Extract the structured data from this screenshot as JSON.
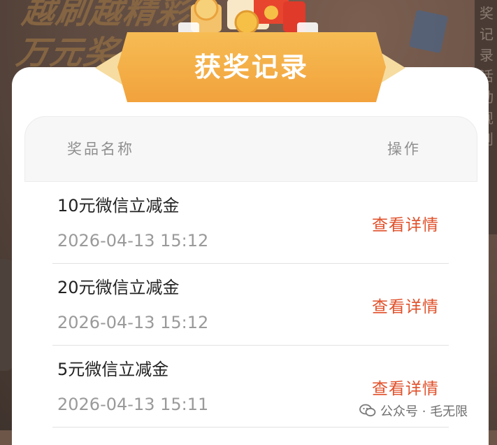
{
  "background": {
    "banner_text": "越刷越精彩\n万元奖",
    "side_text": "奖记录活动规则"
  },
  "modal": {
    "title": "获奖记录",
    "table": {
      "columns": [
        "奖品名称",
        "操作"
      ],
      "rows": [
        {
          "prize": "10元微信立减金",
          "time": "2026-04-13 15:12",
          "action": "查看详情"
        },
        {
          "prize": "20元微信立减金",
          "time": "2026-04-13 15:12",
          "action": "查看详情"
        },
        {
          "prize": "5元微信立减金",
          "time": "2026-04-13 15:11",
          "action": "查看详情"
        }
      ]
    }
  },
  "watermark": {
    "text": "公众号 · 毛无限",
    "icon": "wechat-official-account-icon"
  },
  "colors": {
    "ribbon": "#f2a23c",
    "action_text": "#e0502a",
    "title_text": "#ffffff"
  }
}
